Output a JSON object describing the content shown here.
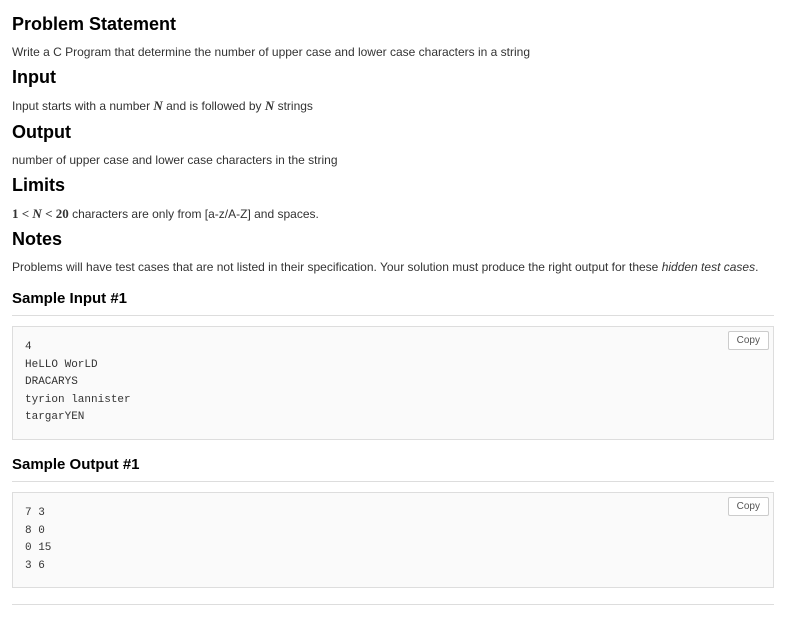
{
  "sections": {
    "problem_statement": {
      "heading": "Problem Statement",
      "text": "Write a C Program that determine the number of upper case and lower case characters in a string"
    },
    "input": {
      "heading": "Input",
      "text_prefix": "Input starts with a number ",
      "text_mid": " and is followed by ",
      "text_suffix": " strings",
      "var": "N"
    },
    "output": {
      "heading": "Output",
      "text": "number of upper case and lower case characters in the string"
    },
    "limits": {
      "heading": "Limits",
      "expr_prefix": "1 < ",
      "expr_var": "N",
      "expr_suffix": " < 20",
      "text_suffix": " characters are only from [a-z/A-Z] and spaces."
    },
    "notes": {
      "heading": "Notes",
      "text_prefix": "Problems will have test cases that are not listed in their specification. Your solution must produce the right output for these ",
      "text_italic": "hidden test cases",
      "text_suffix": "."
    },
    "sample_input": {
      "heading": "Sample Input #1",
      "content": "4\nHeLLO WorLD\nDRACARYS\ntyrion lannister\ntargarYEN"
    },
    "sample_output": {
      "heading": "Sample Output #1",
      "content": "7 3\n8 0\n0 15\n3 6"
    }
  },
  "ui": {
    "copy_label": "Copy"
  }
}
